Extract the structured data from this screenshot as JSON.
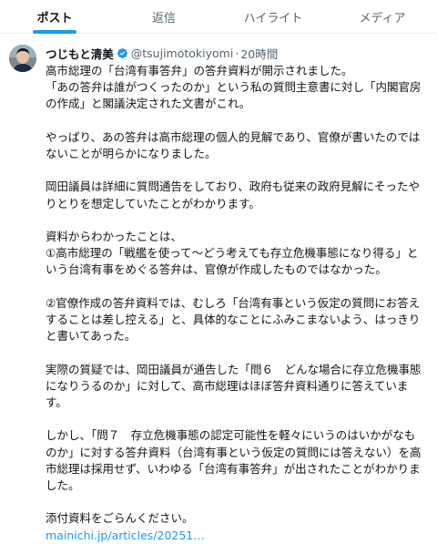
{
  "tabs": [
    {
      "label": "ポスト",
      "active": true
    },
    {
      "label": "返信",
      "active": false
    },
    {
      "label": "ハイライト",
      "active": false
    },
    {
      "label": "メディア",
      "active": false
    }
  ],
  "post": {
    "author_name": "つじもと清美",
    "handle": "@tsujimotokiyomi",
    "separator": "·",
    "time": "20時間",
    "paragraphs": [
      "高市総理の「台湾有事答弁」の答弁資料が開示されました。\n「あの答弁は誰がつくったのか」という私の質問主意書に対し「内閣官房の作成」と閣議決定された文書がこれ。",
      "やっぱり、あの答弁は高市総理の個人的見解であり、官僚が書いたのではないことが明らかになりました。",
      "岡田議員は詳細に質問通告をしており、政府も従来の政府見解にそったやりとりを想定していたことがわかります。",
      "資料からわかったことは、\n①高市総理の「戦艦を使って～どう考えても存立危機事態になり得る」という台湾有事をめぐる答弁は、官僚が作成したものではなかった。",
      "②官僚作成の答弁資料では、むしろ「台湾有事という仮定の質問にお答えすることは差し控える」と、具体的なことにふみこまないよう、はっきりと書いてあった。",
      "実際の質疑では、岡田議員が通告した「問６　どんな場合に存立危機事態になりうるのか」に対して、高市総理はほぼ答弁資料通りに答えています。",
      "しかし、「問７　存立危機事態の認定可能性を軽々にいうのはいかがなものか」に対する答弁資料（台湾有事という仮定の質問には答えない）を高市総理は採用せず、いわゆる「台湾有事答弁」が出されたことがわかりました。",
      "添付資料をごらんください。"
    ],
    "link": "mainichi.jp/articles/20251…"
  },
  "colors": {
    "accent": "#1d9bf0",
    "text": "#0f1419",
    "muted": "#536471",
    "border": "#eff3f4"
  },
  "icons": {
    "verified": "verified-badge-icon",
    "avatar": "profile-avatar"
  }
}
